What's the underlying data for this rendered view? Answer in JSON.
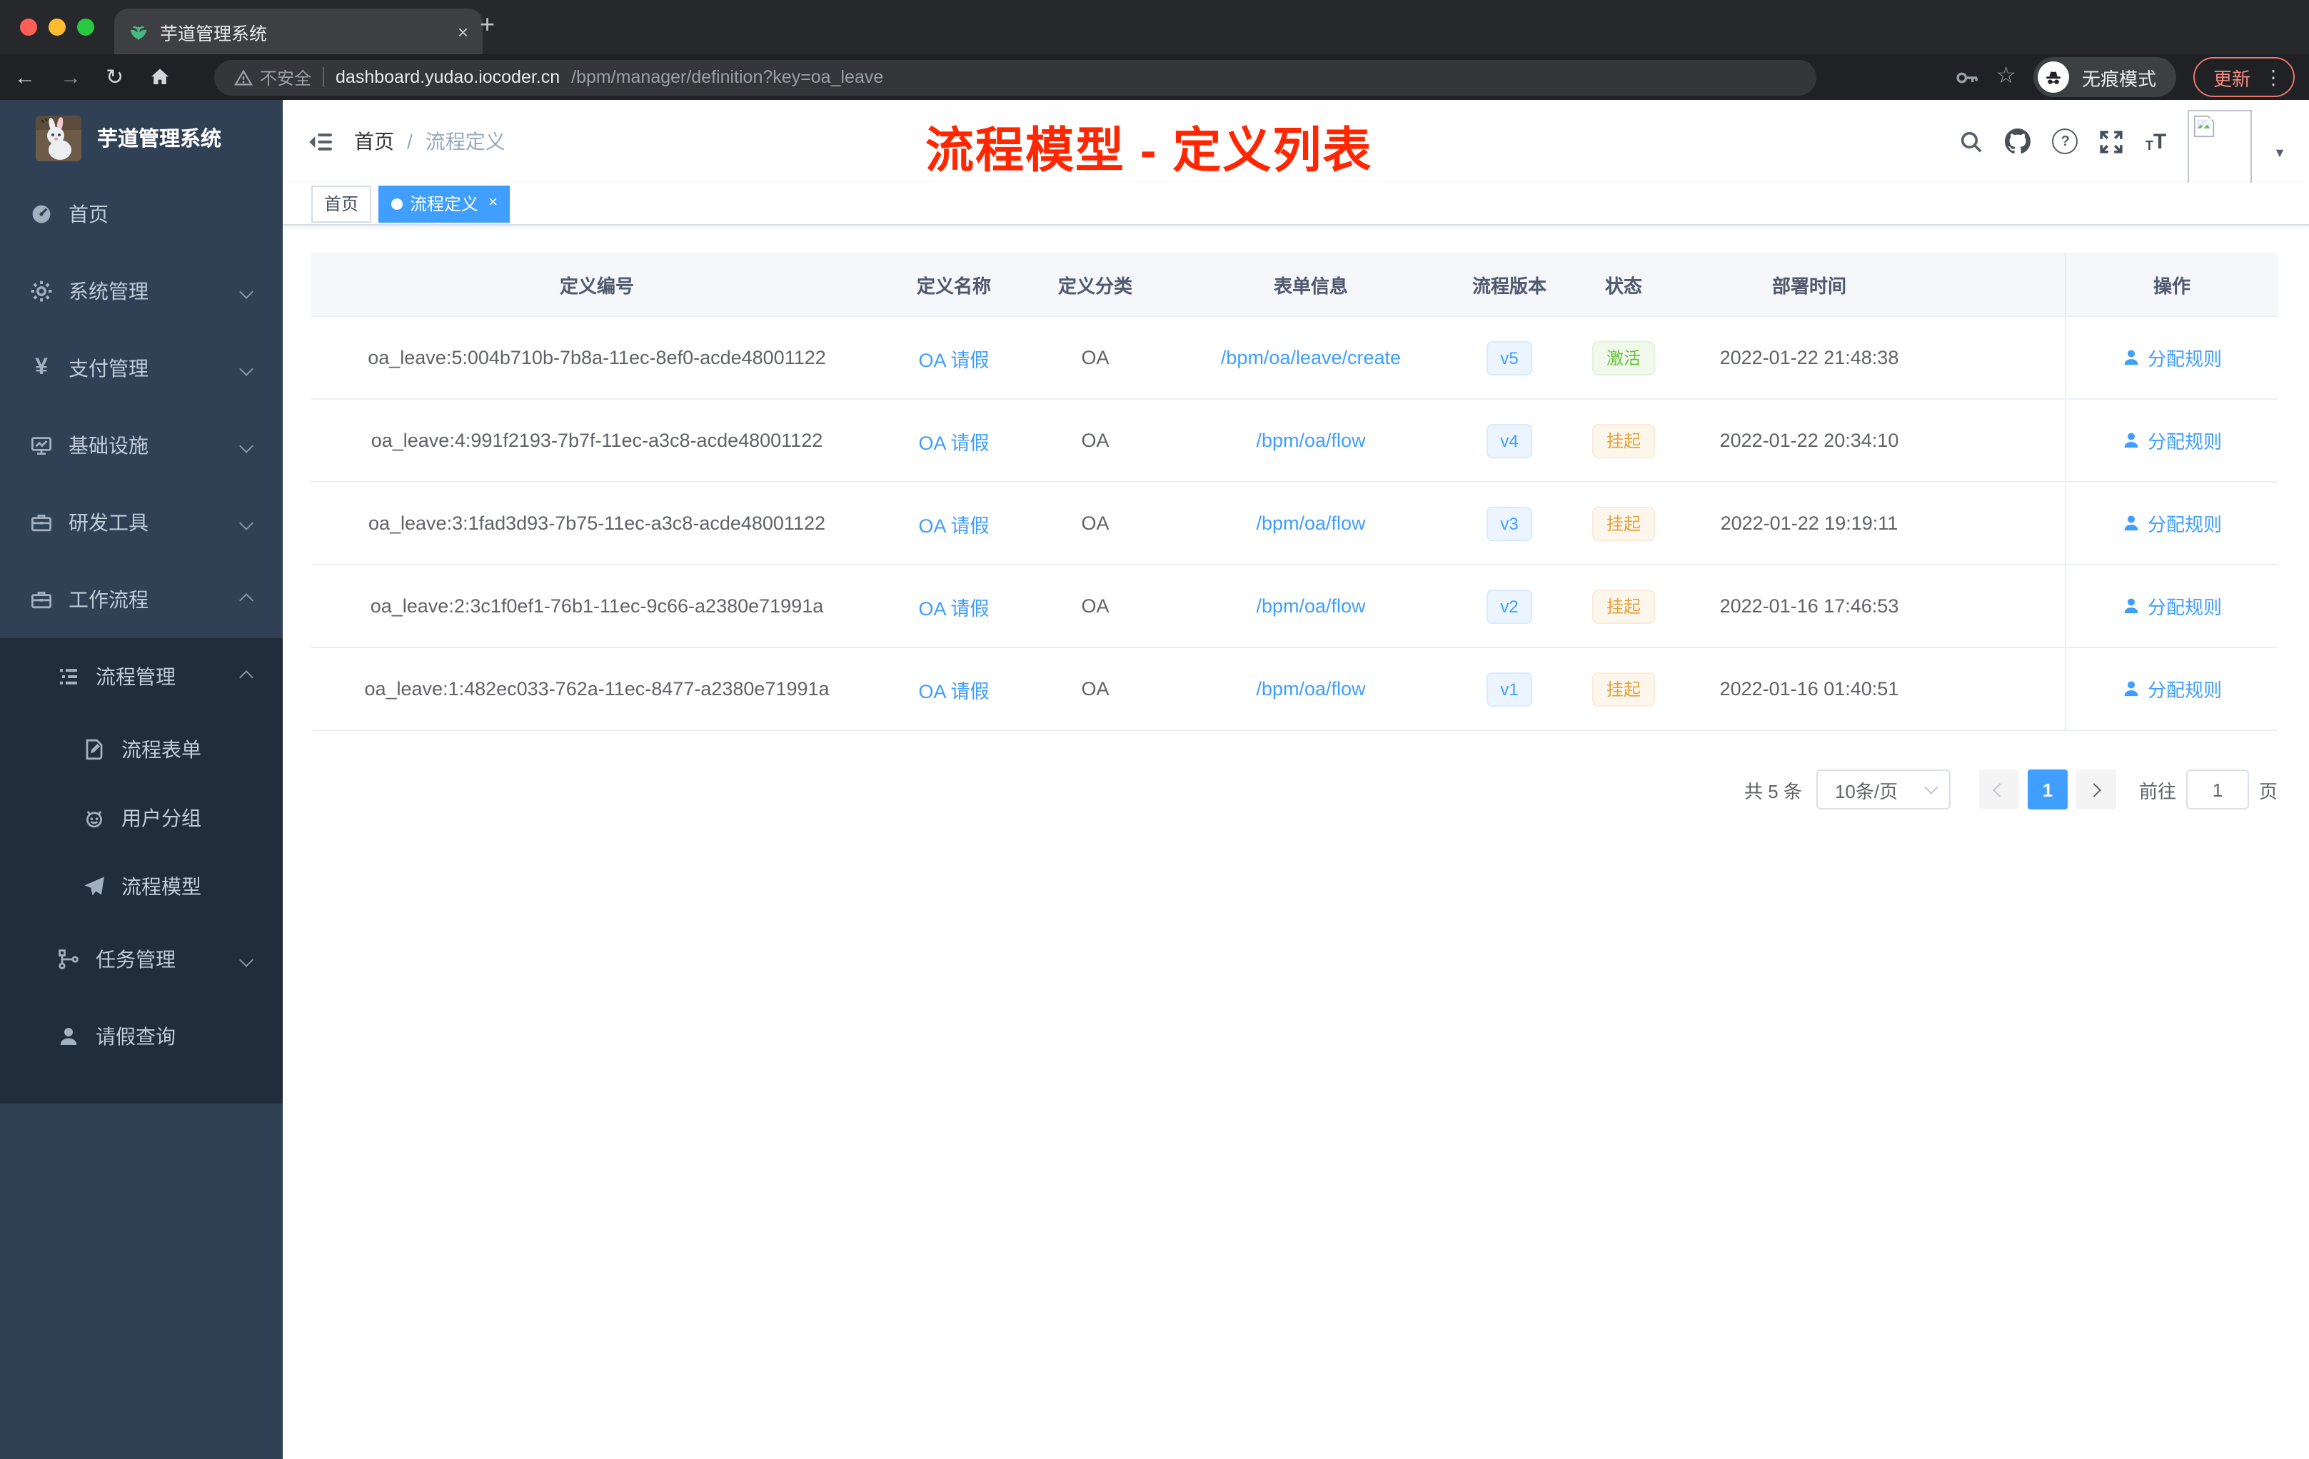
{
  "browser": {
    "tab_title": "芋道管理系统",
    "security": "不安全",
    "url_host": "dashboard.yudao.iocoder.cn",
    "url_path": "/bpm/manager/definition?key=oa_leave",
    "incognito": "无痕模式",
    "update": "更新"
  },
  "icons": {
    "close": "×",
    "new_tab": "+",
    "back": "←",
    "forward": "→",
    "reload": "↻",
    "star": "☆",
    "dots": "⋮",
    "slash": "/",
    "question": "?",
    "currency": "¥",
    "caret": "▼",
    "t_small": "T",
    "t_big": "T"
  },
  "sidebar": {
    "title": "芋道管理系统",
    "menu": {
      "home": "首页",
      "system": "系统管理",
      "pay": "支付管理",
      "infra": "基础设施",
      "dev": "研发工具",
      "workflow": "工作流程",
      "process_mgmt": "流程管理",
      "process_form": "流程表单",
      "user_group": "用户分组",
      "process_model": "流程模型",
      "task_mgmt": "任务管理",
      "leave_query": "请假查询"
    }
  },
  "header": {
    "breadcrumb_home": "首页",
    "breadcrumb_current": "流程定义",
    "annotation": "流程模型 - 定义列表"
  },
  "tags": {
    "home": "首页",
    "active": "流程定义"
  },
  "table": {
    "columns": [
      "定义编号",
      "定义名称",
      "定义分类",
      "表单信息",
      "流程版本",
      "状态",
      "部署时间",
      "操作"
    ],
    "rows": [
      {
        "id": "oa_leave:5:004b710b-7b8a-11ec-8ef0-acde48001122",
        "name": "OA 请假",
        "category": "OA",
        "form": "/bpm/oa/leave/create",
        "version": "v5",
        "status": "激活",
        "time": "2022-01-22 21:48:38",
        "action": "分配规则"
      },
      {
        "id": "oa_leave:4:991f2193-7b7f-11ec-a3c8-acde48001122",
        "name": "OA 请假",
        "category": "OA",
        "form": "/bpm/oa/flow",
        "version": "v4",
        "status": "挂起",
        "time": "2022-01-22 20:34:10",
        "action": "分配规则"
      },
      {
        "id": "oa_leave:3:1fad3d93-7b75-11ec-a3c8-acde48001122",
        "name": "OA 请假",
        "category": "OA",
        "form": "/bpm/oa/flow",
        "version": "v3",
        "status": "挂起",
        "time": "2022-01-22 19:19:11",
        "action": "分配规则"
      },
      {
        "id": "oa_leave:2:3c1f0ef1-76b1-11ec-9c66-a2380e71991a",
        "name": "OA 请假",
        "category": "OA",
        "form": "/bpm/oa/flow",
        "version": "v2",
        "status": "挂起",
        "time": "2022-01-16 17:46:53",
        "action": "分配规则"
      },
      {
        "id": "oa_leave:1:482ec033-762a-11ec-8477-a2380e71991a",
        "name": "OA 请假",
        "category": "OA",
        "form": "/bpm/oa/flow",
        "version": "v1",
        "status": "挂起",
        "time": "2022-01-16 01:40:51",
        "action": "分配规则"
      }
    ]
  },
  "pagination": {
    "total": "共 5 条",
    "page_size": "10条/页",
    "page": "1",
    "goto": "前往",
    "unit": "页",
    "goto_value": "1"
  },
  "colors": {
    "accent": "#409eff",
    "success": "#67c23a",
    "warning": "#e6a23c",
    "annotation": "#ff2600",
    "sidebar_bg": "#304156",
    "submenu_bg": "#212d3b"
  }
}
